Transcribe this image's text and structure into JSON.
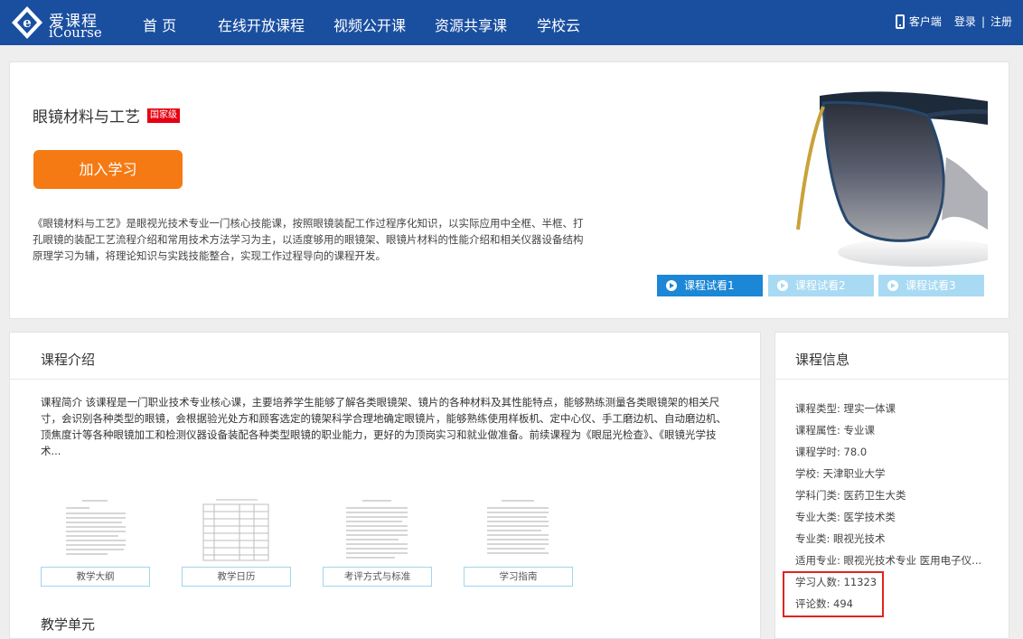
{
  "brand": {
    "name_cn": "爱课程",
    "name_en": "iCourse"
  },
  "nav": {
    "items": [
      "首 页",
      "在线开放课程",
      "视频公开课",
      "资源共享课",
      "学校云"
    ],
    "client_label": "客户端",
    "login_label": "登录",
    "separator": "|",
    "register_label": "注册"
  },
  "hero": {
    "title": "眼镜材料与工艺",
    "badge": "国家级",
    "join_label": "加入学习",
    "description": "《眼镜材料与工艺》是眼视光技术专业一门核心技能课，按照眼镜装配工作过程序化知识，以实际应用中全框、半框、打孔眼镜的装配工艺流程介绍和常用技术方法学习为主，以适度够用的眼镜架、眼镜片材料的性能介绍和相关仪器设备结构原理学习为辅，将理论知识与实践技能整合，实现工作过程导向的课程开发。",
    "trials": [
      "课程试看1",
      "课程试看2",
      "课程试看3"
    ]
  },
  "intro": {
    "title": "课程介绍",
    "text": "课程简介 该课程是一门职业技术专业核心课，主要培养学生能够了解各类眼镜架、镜片的各种材料及其性能特点，能够熟练测量各类眼镜架的相关尺寸，会识别各种类型的眼镜，会根据验光处方和顾客选定的镜架科学合理地确定眼镜片，能够熟练使用样板机、定中心仪、手工磨边机、自动磨边机、顶焦度计等各种眼镜加工和检测仪器设备装配各种类型眼镜的职业能力，更好的为顶岗实习和就业做准备。前续课程为《眼屈光检查》、《眼镜光学技术...",
    "documents": [
      "教学大纲",
      "教学日历",
      "考评方式与标准",
      "学习指南"
    ],
    "units_title": "教学单元"
  },
  "info": {
    "title": "课程信息",
    "rows": [
      "课程类型: 理实一体课",
      "课程属性: 专业课",
      "课程学时: 78.0",
      "学校: 天津职业大学",
      "学科门类: 医药卫生大类",
      "专业大类: 医学技术类",
      "专业类: 眼视光技术",
      "适用专业: 眼视光技术专业 医用电子仪...",
      "学习人数: 11323",
      "评论数: 494"
    ]
  },
  "colors": {
    "nav_bg": "#1a4fa0",
    "join_button": "#f57a14",
    "badge": "#e60012",
    "trial_active": "#1b87d6",
    "trial_inactive": "#a9daf3",
    "highlight": "#e1241d"
  },
  "icons": [
    "icourse-logo-icon",
    "phone-icon",
    "play-icon"
  ]
}
